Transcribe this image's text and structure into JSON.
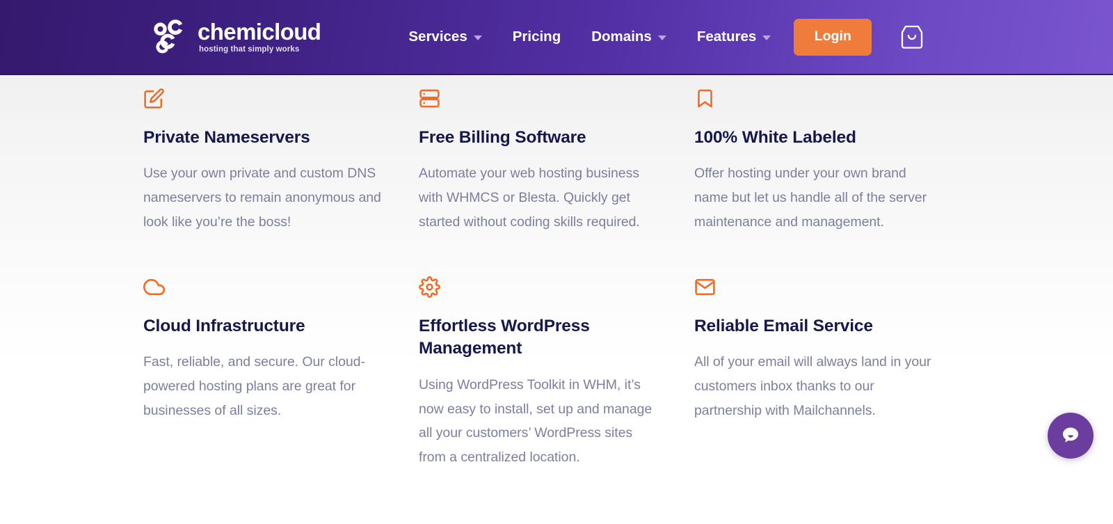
{
  "header": {
    "logo": {
      "mark_icon": "chemicloud-molecule-icon",
      "word": "chemicloud",
      "tagline": "hosting that simply works"
    },
    "nav_items": [
      {
        "label": "Services",
        "has_dropdown": true
      },
      {
        "label": "Pricing",
        "has_dropdown": false
      },
      {
        "label": "Domains",
        "has_dropdown": true
      },
      {
        "label": "Features",
        "has_dropdown": true
      }
    ],
    "login_label": "Login",
    "cart_icon": "shopping-bag-icon",
    "accent_color": "#f07c3c",
    "gradient_start": "#35196e",
    "gradient_end": "#7a55cf"
  },
  "features": {
    "cards": [
      {
        "icon": "edit-square-icon",
        "title": "Private Nameservers",
        "description": "Use your own private and custom DNS nameservers to remain anonymous and look like you’re the boss!"
      },
      {
        "icon": "server-stack-icon",
        "title": "Free Billing Software",
        "description": "Automate your web hosting business with WHMCS or Blesta. Quickly get started without coding skills required."
      },
      {
        "icon": "bookmark-icon",
        "title": "100% White Labeled",
        "description": "Offer hosting under your own brand name but let us handle all of the server maintenance and management."
      },
      {
        "icon": "cloud-icon",
        "title": "Cloud Infrastructure",
        "description": "Fast, reliable, and secure. Our cloud-powered hosting plans are great for businesses of all sizes."
      },
      {
        "icon": "gear-icon",
        "title": "Effortless WordPress Management",
        "description": "Using WordPress Toolkit in WHM, it’s now easy to install, set up and manage all your customers’ WordPress sites from a centralized location."
      },
      {
        "icon": "envelope-icon",
        "title": "Reliable Email Service",
        "description": "All of your email will always land in your customers inbox thanks to our partnership with Mailchannels."
      }
    ],
    "icon_color": "#f26b21",
    "title_color": "#16174a",
    "text_color": "#7b7f9e"
  },
  "chat": {
    "icon": "chat-bubble-icon",
    "color": "#6a3d9f"
  }
}
